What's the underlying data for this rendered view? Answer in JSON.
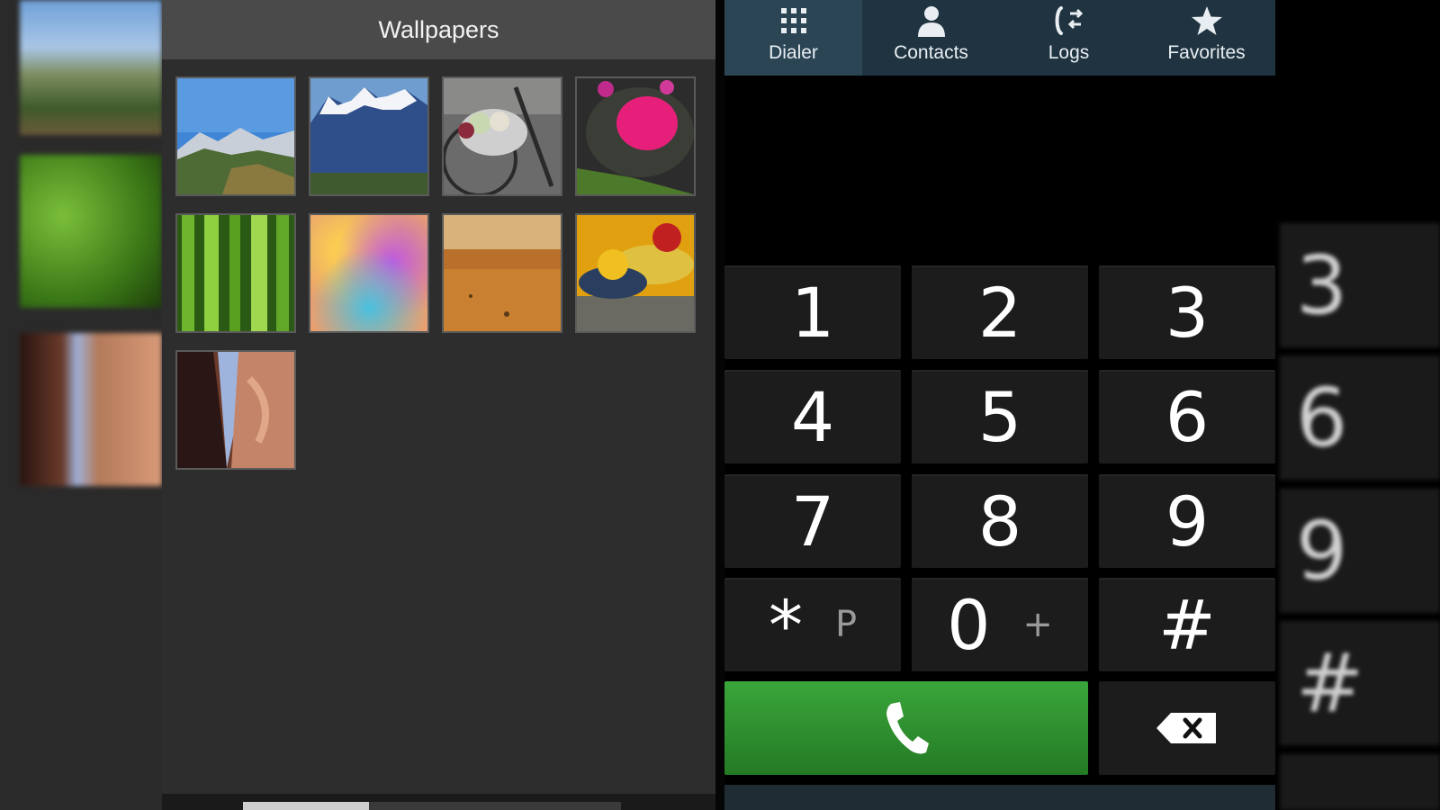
{
  "wallpapers": {
    "title": "Wallpapers",
    "thumbnails": [
      {
        "name": "mountain-valley"
      },
      {
        "name": "snowy-mountains"
      },
      {
        "name": "bicycle-basket"
      },
      {
        "name": "pink-flowers-bowl"
      },
      {
        "name": "green-forest"
      },
      {
        "name": "colorful-blur"
      },
      {
        "name": "desert-savanna"
      },
      {
        "name": "fruit-bowl"
      },
      {
        "name": "canyon-rock"
      }
    ]
  },
  "phone": {
    "tabs": [
      {
        "label": "Dialer",
        "icon": "keypad-icon",
        "active": true
      },
      {
        "label": "Contacts",
        "icon": "person-icon"
      },
      {
        "label": "Logs",
        "icon": "call-log-icon"
      },
      {
        "label": "Favorites",
        "icon": "star-icon"
      }
    ],
    "keys": [
      {
        "main": "1"
      },
      {
        "main": "2"
      },
      {
        "main": "3"
      },
      {
        "main": "4"
      },
      {
        "main": "5"
      },
      {
        "main": "6"
      },
      {
        "main": "7"
      },
      {
        "main": "8"
      },
      {
        "main": "9"
      },
      {
        "main": "*",
        "sub": "P"
      },
      {
        "main": "0",
        "sub": "+"
      },
      {
        "main": "#"
      }
    ],
    "call_icon": "phone-handset-icon",
    "delete_icon": "backspace-icon"
  },
  "blurred_right": {
    "keys": [
      "3",
      "6",
      "9",
      "#"
    ]
  },
  "colors": {
    "call_green": "#2e8b2e",
    "tab_bar": "#1f3340",
    "panel_bg": "#2d2d2d"
  }
}
